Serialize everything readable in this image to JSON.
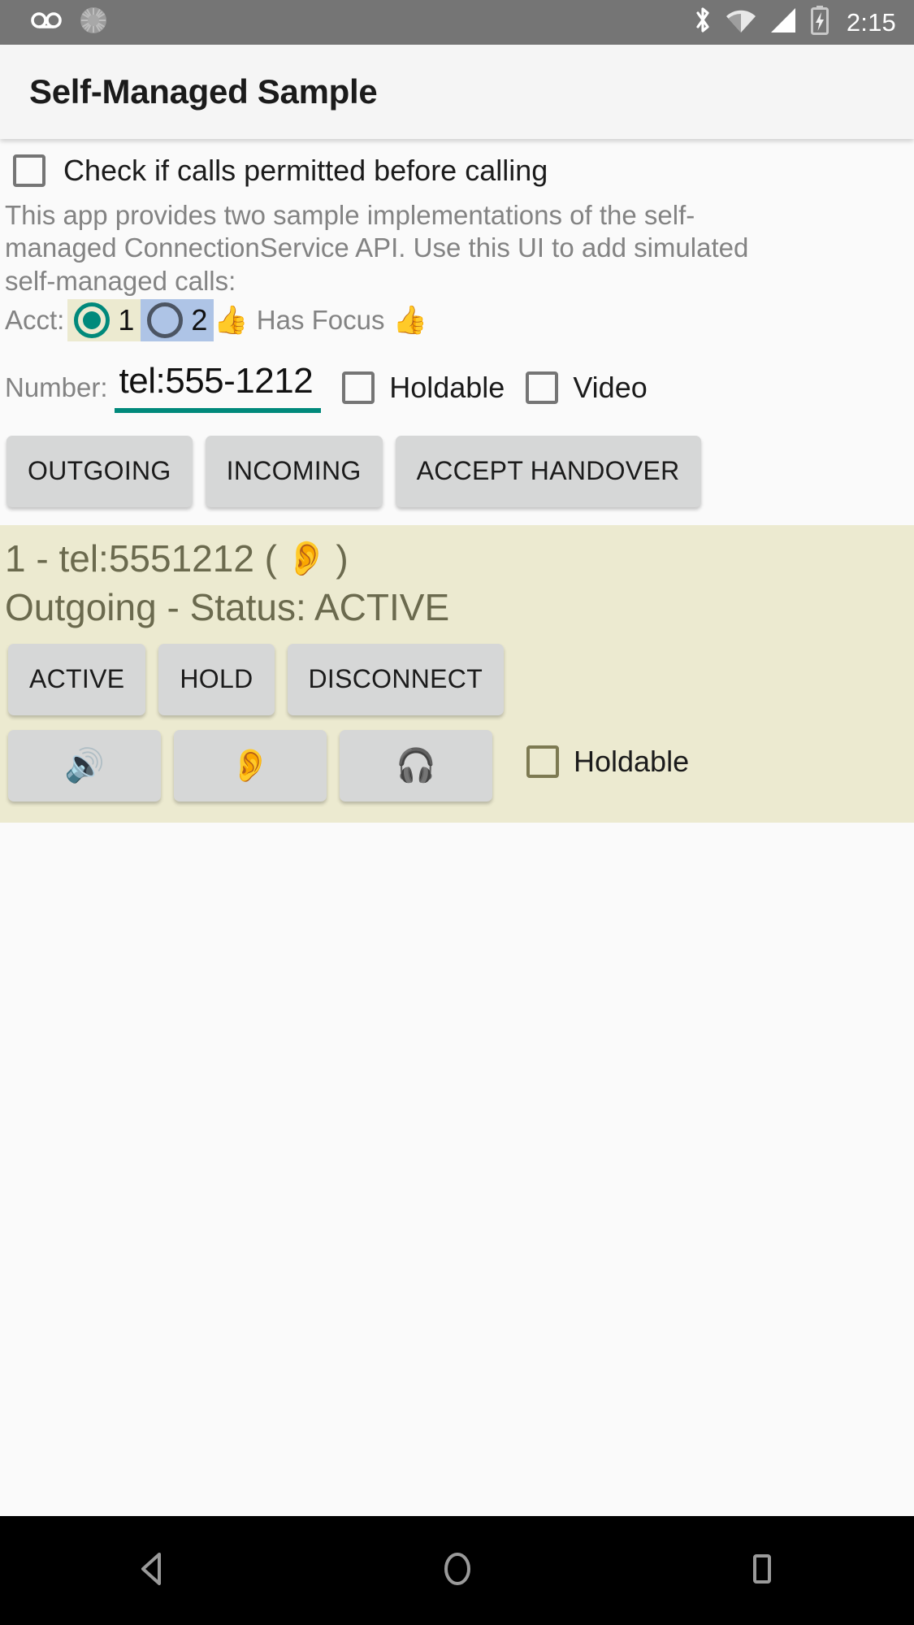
{
  "status_bar": {
    "icons": [
      "voicemail-icon",
      "sync-icon",
      "bluetooth-icon",
      "wifi-icon",
      "signal-icon",
      "battery-charging-icon"
    ],
    "time": "2:15"
  },
  "app_bar": {
    "title": "Self-Managed Sample"
  },
  "settings": {
    "check_permission_label": "Check if calls permitted before calling",
    "check_permission_checked": false
  },
  "description": "This app provides two sample implementations of the self-managed ConnectionService API.  Use this UI to add simulated self-managed calls:",
  "account": {
    "label": "Acct:",
    "options": [
      {
        "value": "1",
        "selected": true,
        "bg": "#ecead0"
      },
      {
        "value": "2",
        "selected": false,
        "bg": "#aec4e6"
      }
    ],
    "focus_emoji_left": "👍",
    "focus_label": "Has Focus",
    "focus_emoji_right": "👍"
  },
  "number_row": {
    "label": "Number:",
    "value": "tel:555-1212",
    "placeholder": "tel:555-1212",
    "holdable_label": "Holdable",
    "holdable_checked": false,
    "video_label": "Video",
    "video_checked": false
  },
  "actions": {
    "outgoing": "OUTGOING",
    "incoming": "INCOMING",
    "accept_handover": "ACCEPT HANDOVER"
  },
  "call_card": {
    "background": "#ecead0",
    "title_prefix": "1 - tel:5551212 (",
    "route_emoji": "👂",
    "title_suffix": ")",
    "status_line": "Outgoing - Status: ACTIVE",
    "state_buttons": [
      "ACTIVE",
      "HOLD",
      "DISCONNECT"
    ],
    "audio_buttons": [
      {
        "name": "speaker",
        "emoji": "🔊"
      },
      {
        "name": "earpiece",
        "emoji": "👂"
      },
      {
        "name": "headset",
        "emoji": "🎧"
      }
    ],
    "holdable_label": "Holdable",
    "holdable_checked": false
  },
  "nav_bar": {
    "back": "back-icon",
    "home": "home-icon",
    "recents": "recents-icon"
  },
  "colors": {
    "accent": "#00897b",
    "card_yellow": "#ecead0",
    "acct2_blue": "#aec4e6",
    "button_gray": "#d6d7d7",
    "status_bar": "#757575"
  }
}
